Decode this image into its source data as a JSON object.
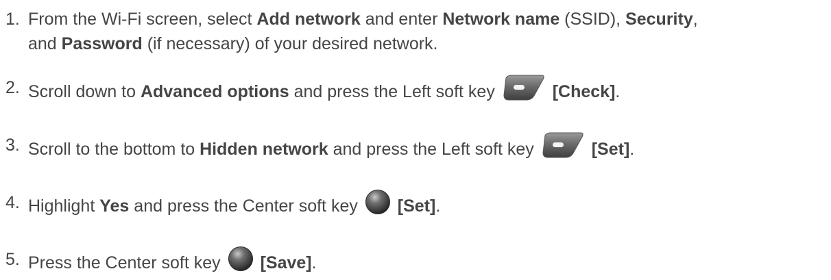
{
  "steps": [
    {
      "number": "1.",
      "parts": {
        "t1": "From the Wi-Fi screen, select ",
        "b1": "Add network",
        "t2": " and enter ",
        "b2": "Network name",
        "t3": " (SSID), ",
        "b3": "Security",
        "t4": ",",
        "t5": "and ",
        "b4": "Password",
        "t6": " (if necessary) of your desired network."
      }
    },
    {
      "number": "2.",
      "parts": {
        "t1": "Scroll down to ",
        "b1": "Advanced options",
        "t2": " and press the Left soft key ",
        "b2": "[Check]",
        "t3": "."
      },
      "key_icon": "left-soft-key-icon"
    },
    {
      "number": "3.",
      "parts": {
        "t1": "Scroll to the bottom to ",
        "b1": "Hidden network",
        "t2": " and press the Left soft key ",
        "b2": "[Set]",
        "t3": "."
      },
      "key_icon": "left-soft-key-icon"
    },
    {
      "number": "4.",
      "parts": {
        "t1": "Highlight ",
        "b1": "Yes",
        "t2": " and press the Center soft key ",
        "b2": "[Set]",
        "t3": "."
      },
      "key_icon": "center-soft-key-icon"
    },
    {
      "number": "5.",
      "parts": {
        "t1": "Press the Center soft key ",
        "b1": "[Save]",
        "t2": "."
      },
      "key_icon": "center-soft-key-icon"
    }
  ],
  "colors": {
    "text": "#454545",
    "background": "#ffffff"
  }
}
